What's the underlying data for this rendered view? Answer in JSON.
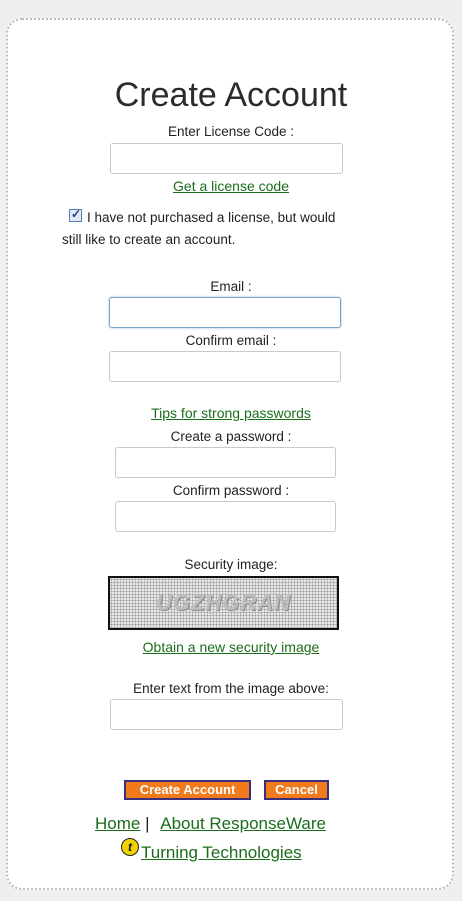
{
  "form": {
    "title": "Create Account",
    "license_label": "Enter License Code :",
    "license_value": "",
    "get_license_link": "Get a license code",
    "no_license_checkbox": {
      "checked": true,
      "label_line1": "I have not purchased a license, but would",
      "label_line2": "still like to create an account."
    },
    "email_label": "Email :",
    "email_value": "",
    "confirm_email_label": "Confirm email :",
    "confirm_email_value": "",
    "password_tips_link": "Tips for strong passwords",
    "password_label": "Create a password :",
    "confirm_password_label": "Confirm password :",
    "security_image_label": "Security image:",
    "captcha_text": "UGZHGRAN",
    "new_image_link": "Obtain a new security image",
    "captcha_input_label": "Enter text from the image above:",
    "captcha_input_value": ""
  },
  "buttons": {
    "create_account": "Create Account",
    "cancel": "Cancel"
  },
  "footer": {
    "home_link": "Home",
    "separator": "|",
    "about_link": "About ResponseWare",
    "company_link": "Turning Technologies",
    "company_icon": "turning-logo-icon"
  }
}
